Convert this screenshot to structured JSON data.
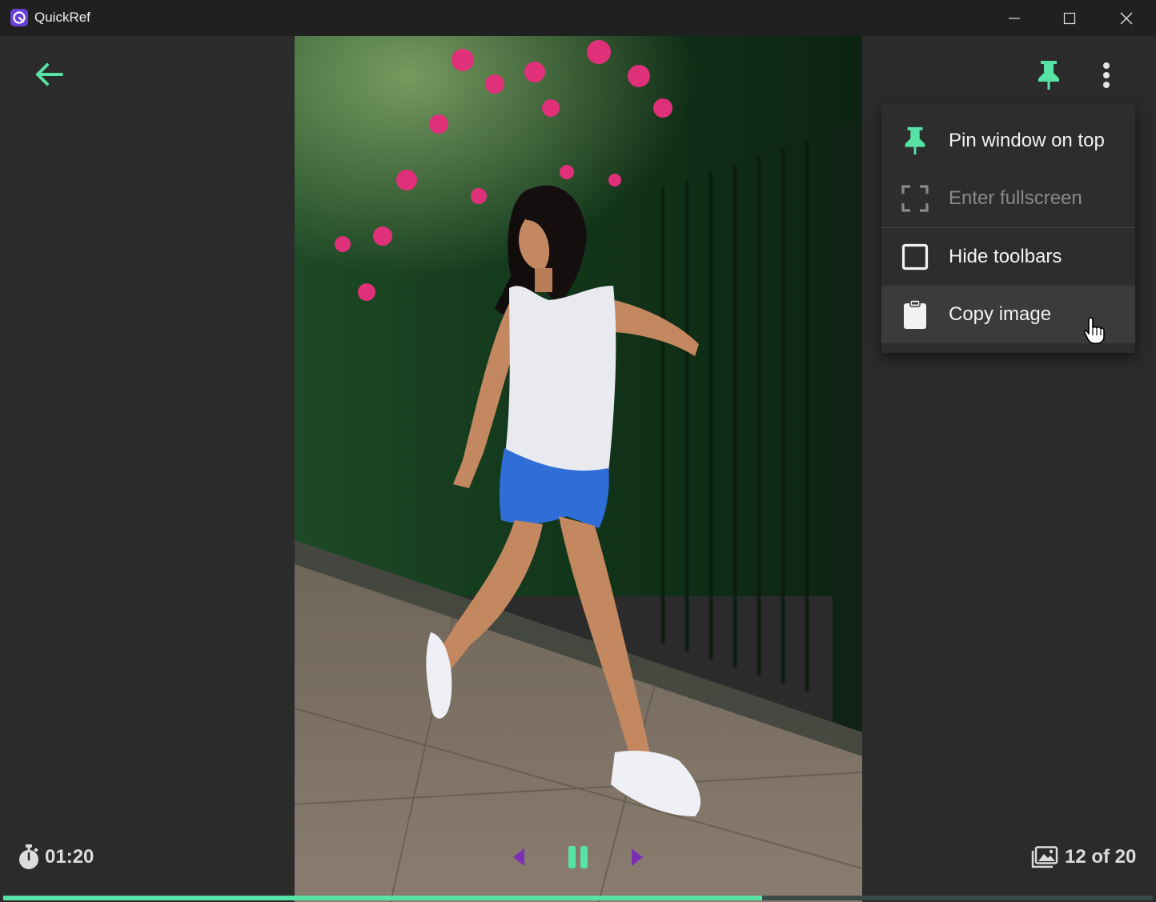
{
  "window": {
    "title": "QuickRef",
    "controls": [
      "minimize",
      "maximize",
      "close"
    ]
  },
  "colors": {
    "accent": "#57e3a5",
    "nav_purple": "#7b2fb5",
    "menu_bg": "#2d2d2d"
  },
  "toolbar": {
    "back_icon": "arrow-left-icon",
    "pin_icon": "pushpin-icon",
    "more_icon": "more-vertical-icon"
  },
  "menu": {
    "items": [
      {
        "label": "Pin window on top",
        "icon": "pushpin-icon",
        "enabled": true
      },
      {
        "label": "Enter fullscreen",
        "icon": "fullscreen-icon",
        "enabled": false
      },
      {
        "label": "Hide toolbars",
        "icon": "checkbox-icon",
        "enabled": true,
        "checked": false
      },
      {
        "label": "Copy image",
        "icon": "clipboard-icon",
        "enabled": true,
        "hovered": true
      }
    ]
  },
  "session": {
    "timer": "01:20",
    "counter": "12 of 20",
    "progress": 0.66
  }
}
